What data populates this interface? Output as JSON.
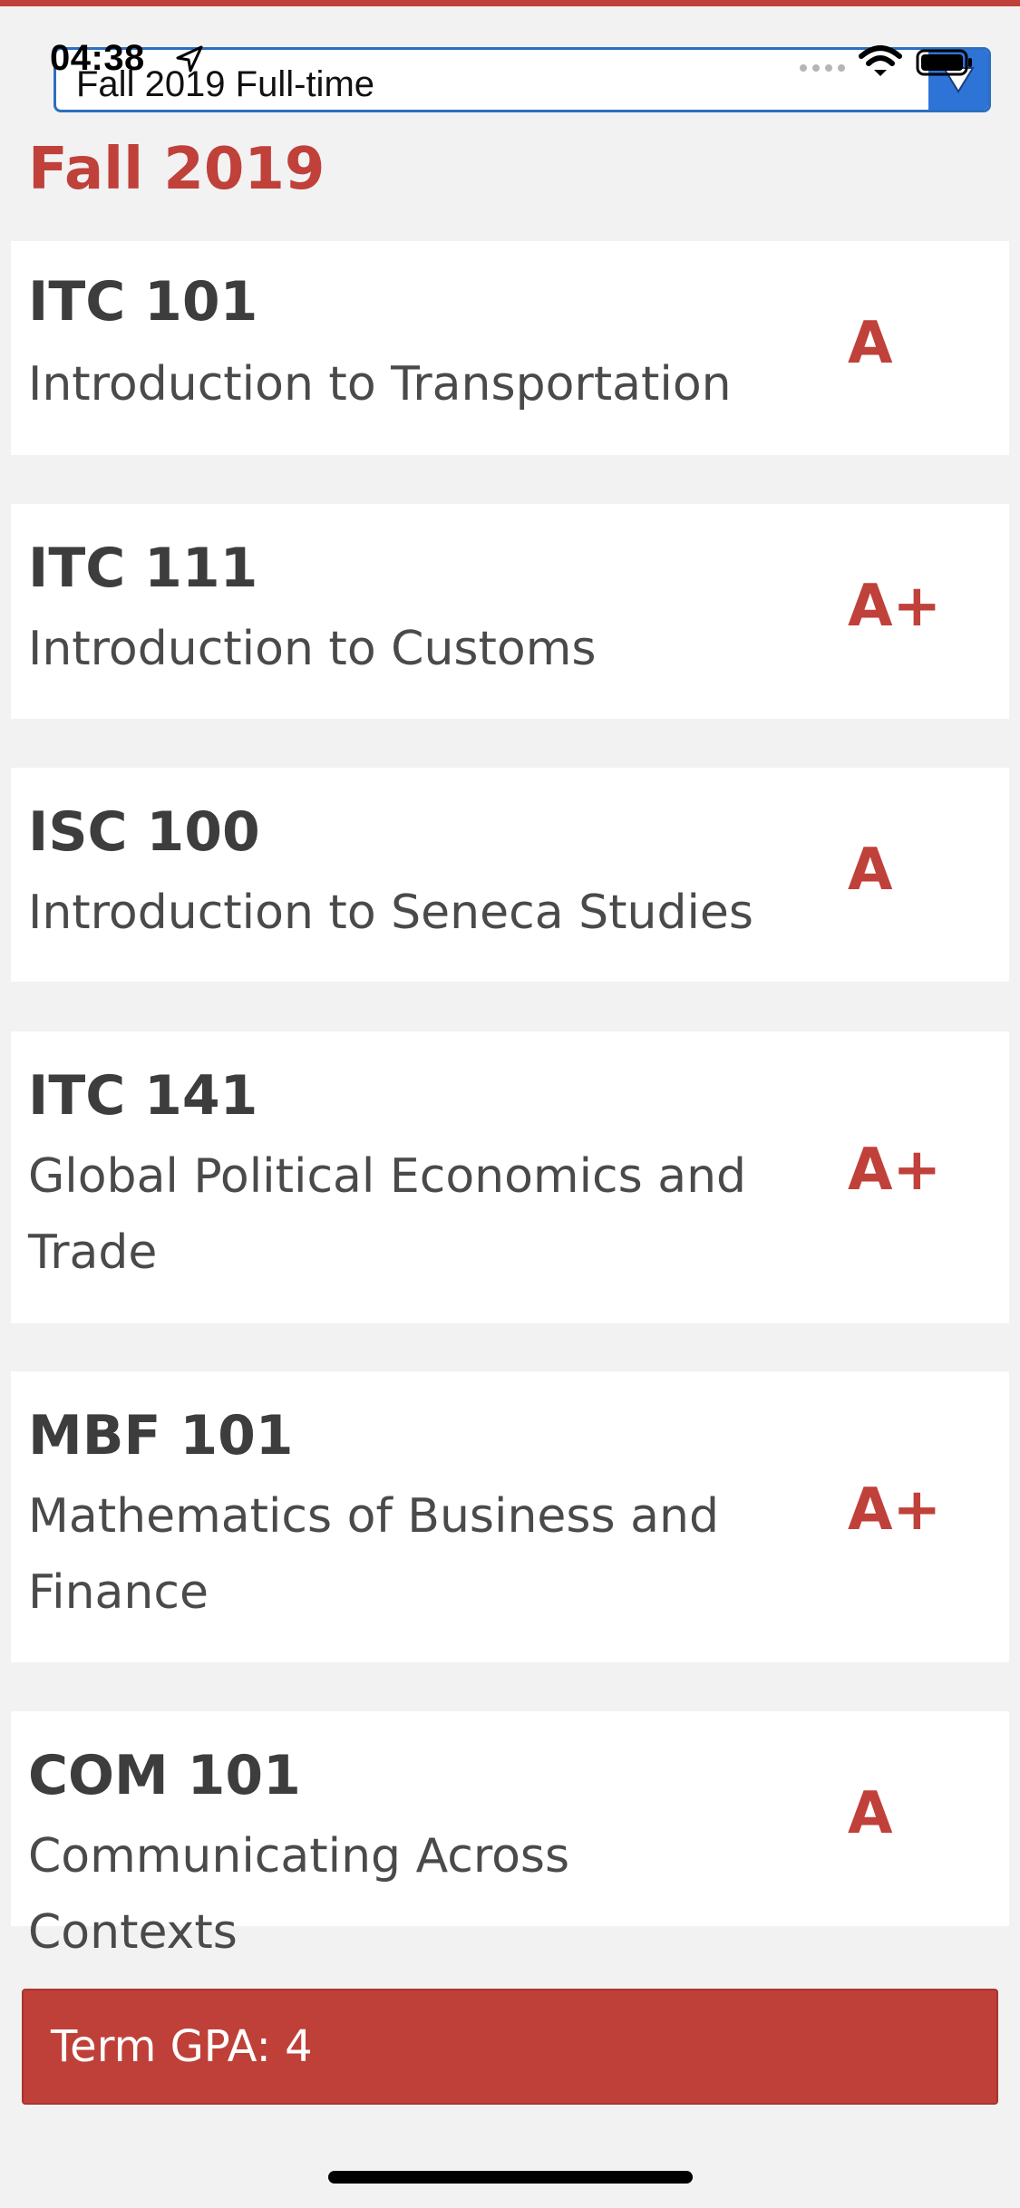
{
  "status_bar": {
    "time": "04:38",
    "icons": [
      "location-arrow-icon",
      "cellular-signal-icon",
      "wifi-icon",
      "battery-icon"
    ]
  },
  "term_selector": {
    "value": "Fall 2019 Full-time",
    "icon": "dropdown-triangle-icon"
  },
  "section": {
    "title": "Fall 2019"
  },
  "courses": [
    {
      "code": "ITC 101",
      "name": "Introduction to Transportation",
      "grade": "A"
    },
    {
      "code": "ITC 111",
      "name": "Introduction to Customs",
      "grade": "A+"
    },
    {
      "code": "ISC 100",
      "name": "Introduction to Seneca Studies",
      "grade": "A"
    },
    {
      "code": "ITC 141",
      "name": "Global Political Economics and Trade",
      "grade": "A+"
    },
    {
      "code": "MBF 101",
      "name": "Mathematics of Business and Finance",
      "grade": "A+"
    },
    {
      "code": "COM 101",
      "name": "Communicating Across Contexts",
      "grade": "A"
    }
  ],
  "gpa": {
    "text": "Term GPA: 4"
  },
  "colors": {
    "accent": "#c0403a",
    "select_border": "#2e6ec0",
    "background": "#f2f2f2"
  }
}
